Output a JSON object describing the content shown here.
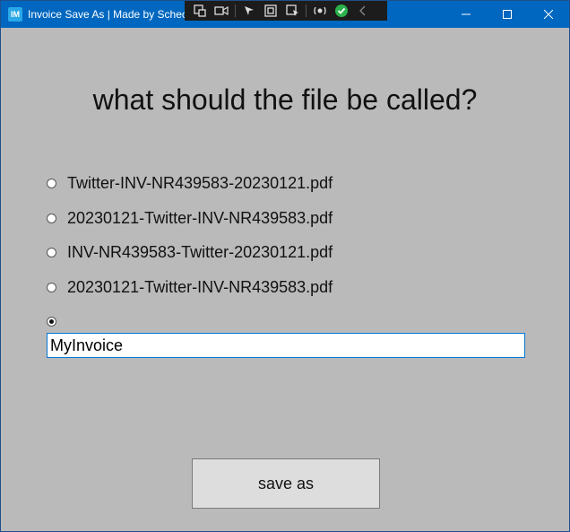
{
  "window": {
    "title": "Invoice Save As | Made by Schech",
    "app_icon_text": "IM"
  },
  "overlay_toolbar": {
    "icons": [
      "live-visual-tree-icon",
      "record-icon",
      "select-element-icon",
      "display-layout-adorners-icon",
      "track-focus-icon",
      "hot-reload-icon",
      "binding-check-icon",
      "collapse-toolbar-icon"
    ]
  },
  "colors": {
    "titlebar": "#0067c0",
    "background": "#bababa",
    "input_border": "#0078d7",
    "button_face": "#dddddd",
    "check_green": "#2bb14b"
  },
  "heading": "what should the file be called?",
  "options": [
    {
      "label": "Twitter-INV-NR439583-20230121.pdf",
      "checked": false
    },
    {
      "label": "20230121-Twitter-INV-NR439583.pdf",
      "checked": false
    },
    {
      "label": "INV-NR439583-Twitter-20230121.pdf",
      "checked": false
    },
    {
      "label": "20230121-Twitter-INV-NR439583.pdf",
      "checked": false
    },
    {
      "label": "",
      "checked": true
    }
  ],
  "custom_name": {
    "value": "MyInvoice"
  },
  "save_button": {
    "label": "save as"
  }
}
